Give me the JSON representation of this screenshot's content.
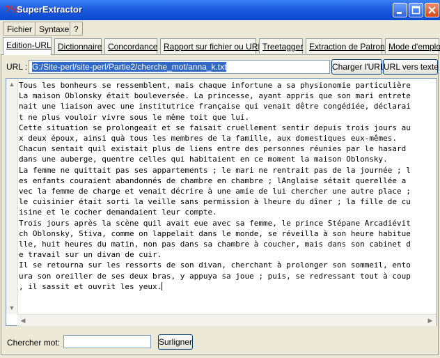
{
  "window": {
    "icon_text": "7½",
    "title": "SuperExtractor"
  },
  "menu": {
    "items": [
      "Fichier",
      "Syntaxe",
      "?"
    ]
  },
  "tabs": [
    "Edition-URL",
    "Dictionnaire",
    "Concordance",
    "Rapport sur fichier ou URL",
    "Treetagger",
    "Extraction de Patron",
    "Mode d'emploi"
  ],
  "url_bar": {
    "label": "URL :",
    "value": "G:/Site-perl/site-perl/Partie2/cherche_mot/anna_k.txt",
    "load_button": "Charger l'URL",
    "to_text_button": "URL vers texte"
  },
  "text_lines": [
    "Tous les bonheurs se ressemblent, mais chaque infortune a sa physionomie particulière",
    "La maison Oblonsky était bouleversée. La princesse, ayant appris que son mari entrete",
    "nait une liaison avec une institutrice française qui venait dêtre congédiée, déclarai",
    "t ne plus vouloir vivre sous le même toit que lui.",
    "Cette situation se prolongeait et se faisait cruellement sentir depuis trois jours au",
    "x deux époux, ainsi quà tous les membres de la famille, aux domestiques eux-mêmes.",
    "Chacun sentait quil existait plus de liens entre des personnes réunies par le hasard",
    "dans une auberge, quentre celles qui habitaient en ce moment la maison Oblonsky.",
    "La femme ne quittait pas ses appartements ; le mari ne rentrait pas de la journée ; l",
    "es enfants couraient abandonnés de chambre en chambre ; lAnglaise sétait querellée a",
    "vec la femme de charge et venait décrire à une amie de lui chercher une autre place ;",
    "le cuisinier était sorti la veille sans permission à lheure du dîner ; la fille de cu",
    "isine et le cocher demandaient leur compte.",
    "Trois jours après la scène quil avait eue avec sa femme, le prince Stépane Arcadiévit",
    "ch Oblonsky, Stiva, comme on lappelait dans le monde, se réveilla à son heure habitue",
    "lle, huit heures du matin, non pas dans sa chambre à coucher, mais dans son cabinet d",
    "e travail sur un divan de cuir.",
    "Il se retourna sur les ressorts de son divan, cherchant à prolonger son sommeil, ento",
    "ura son oreiller de ses deux bras, y appuya sa joue ; puis, se redressant tout à coup",
    ", il sassit et ouvrit les yeux."
  ],
  "search": {
    "label": "Chercher mot:",
    "value": "",
    "button": "Surligner"
  }
}
